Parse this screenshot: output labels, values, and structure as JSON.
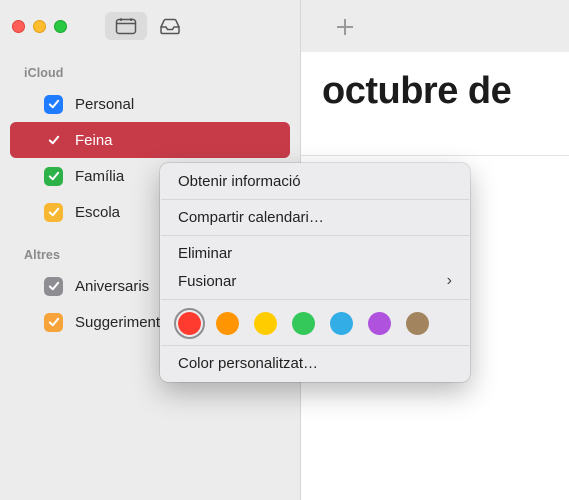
{
  "header": {
    "month_title": "octubre de"
  },
  "sidebar": {
    "sections": [
      {
        "label": "iCloud",
        "items": [
          {
            "label": "Personal",
            "color": "#1f7bff",
            "selected": false
          },
          {
            "label": "Feina",
            "color": "#c73b49",
            "selected": true
          },
          {
            "label": "Família",
            "color": "#2db24a",
            "selected": false
          },
          {
            "label": "Escola",
            "color": "#f7b733",
            "selected": false
          }
        ]
      },
      {
        "label": "Altres",
        "items": [
          {
            "label": "Aniversaris",
            "color": "#8e8e92",
            "selected": false
          },
          {
            "label": "Suggeriments de Siri",
            "color": "#f7a33b",
            "selected": false
          }
        ]
      }
    ]
  },
  "context_menu": {
    "get_info": "Obtenir informació",
    "share": "Compartir calendari…",
    "delete": "Eliminar",
    "merge": "Fusionar",
    "custom_color": "Color personalitzat…",
    "colors": [
      {
        "hex": "#ff3b30",
        "picked": true
      },
      {
        "hex": "#ff9500",
        "picked": false
      },
      {
        "hex": "#ffcc00",
        "picked": false
      },
      {
        "hex": "#34c759",
        "picked": false
      },
      {
        "hex": "#32ade6",
        "picked": false
      },
      {
        "hex": "#af52de",
        "picked": false
      },
      {
        "hex": "#a2845e",
        "picked": false
      }
    ]
  }
}
